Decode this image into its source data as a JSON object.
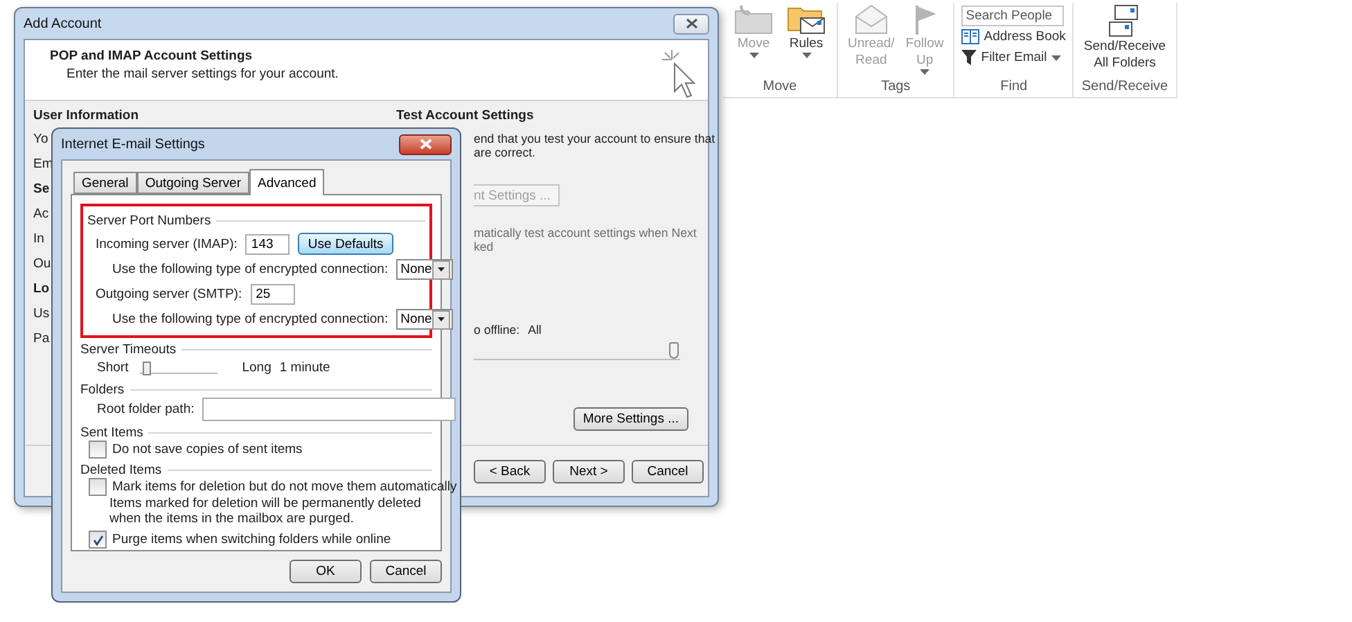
{
  "ribbon": {
    "groups": [
      {
        "label": "Move",
        "buttons": [
          {
            "kind": "move",
            "lines": [
              "Move"
            ],
            "disabled": true,
            "dropdown": true
          },
          {
            "kind": "rules",
            "lines": [
              "Rules"
            ],
            "disabled": false,
            "dropdown": true
          }
        ]
      },
      {
        "label": "Tags",
        "buttons": [
          {
            "kind": "envelope",
            "lines": [
              "Unread/",
              "Read"
            ],
            "disabled": true,
            "dropdown": false
          },
          {
            "kind": "flag",
            "lines": [
              "Follow",
              "Up"
            ],
            "disabled": true,
            "dropdown": true
          }
        ]
      },
      {
        "label": "Find",
        "search": {
          "placeholder": "Search People"
        },
        "links": [
          {
            "kind": "book",
            "label": "Address Book",
            "dropdown": false
          },
          {
            "kind": "filter",
            "label": "Filter Email",
            "dropdown": true
          }
        ]
      },
      {
        "label": "Send/Receive",
        "buttons": [
          {
            "kind": "sendreceive",
            "lines": [
              "Send/Receive",
              "All Folders"
            ],
            "disabled": false,
            "dropdown": false
          }
        ]
      }
    ]
  },
  "add_account": {
    "title": "Add Account",
    "heading": "POP and IMAP Account Settings",
    "subheading": "Enter the mail server settings for your account.",
    "user_info_heading": "User Information",
    "left_fragments": [
      {
        "text": "Yo",
        "bold": false
      },
      {
        "text": "Em",
        "bold": false
      },
      {
        "text": "Se",
        "bold": true
      },
      {
        "text": "Ac",
        "bold": false
      },
      {
        "text": "In",
        "bold": false
      },
      {
        "text": "Ou",
        "bold": false
      },
      {
        "text": "Lo",
        "bold": true
      },
      {
        "text": "Us",
        "bold": false
      },
      {
        "text": "Pa",
        "bold": false
      }
    ],
    "test_heading": "Test Account Settings",
    "test_text": [
      "end that you test your account to ensure that",
      "are correct."
    ],
    "test_button": {
      "label": "nt Settings ...",
      "disabled": true
    },
    "auto_text": [
      "matically test account settings when Next",
      "ked"
    ],
    "offline_label": "o offline:",
    "offline_value": "All",
    "offline_slider": {
      "level": 1
    },
    "more_settings": "More Settings ...",
    "buttons": [
      "< Back",
      "Next >",
      "Cancel"
    ]
  },
  "dialog": {
    "title": "Internet E-mail Settings",
    "tabs": [
      {
        "label": "General",
        "selected": false
      },
      {
        "label": "Outgoing Server",
        "selected": false
      },
      {
        "label": "Advanced",
        "selected": true
      }
    ],
    "server_ports": {
      "title": "Server Port Numbers",
      "highlighted": true,
      "rows": [
        {
          "kind": "port",
          "label": "Incoming server (IMAP):",
          "value": "143",
          "button": "Use Defaults"
        },
        {
          "kind": "select",
          "label": "Use the following type of encrypted connection:",
          "value": "None"
        },
        {
          "kind": "port",
          "label": "Outgoing server (SMTP):",
          "value": "25"
        },
        {
          "kind": "select",
          "label": "Use the following type of encrypted connection:",
          "value": "None"
        }
      ]
    },
    "timeouts": {
      "title": "Server Timeouts",
      "short": "Short",
      "long": "Long",
      "value": "1 minute",
      "level": 0.1
    },
    "folders": {
      "title": "Folders",
      "label": "Root folder path:"
    },
    "sent": {
      "title": "Sent Items",
      "checkbox": {
        "label": "Do not save copies of sent items",
        "checked": false
      }
    },
    "deleted": {
      "title": "Deleted Items",
      "mark": {
        "label": "Mark items for deletion but do not move them automatically",
        "checked": false
      },
      "note": "Items marked for deletion will be permanently deleted when the items in the mailbox are purged.",
      "purge": {
        "label": "Purge items when switching folders while online",
        "checked": true
      }
    },
    "buttons": [
      "OK",
      "Cancel"
    ]
  }
}
